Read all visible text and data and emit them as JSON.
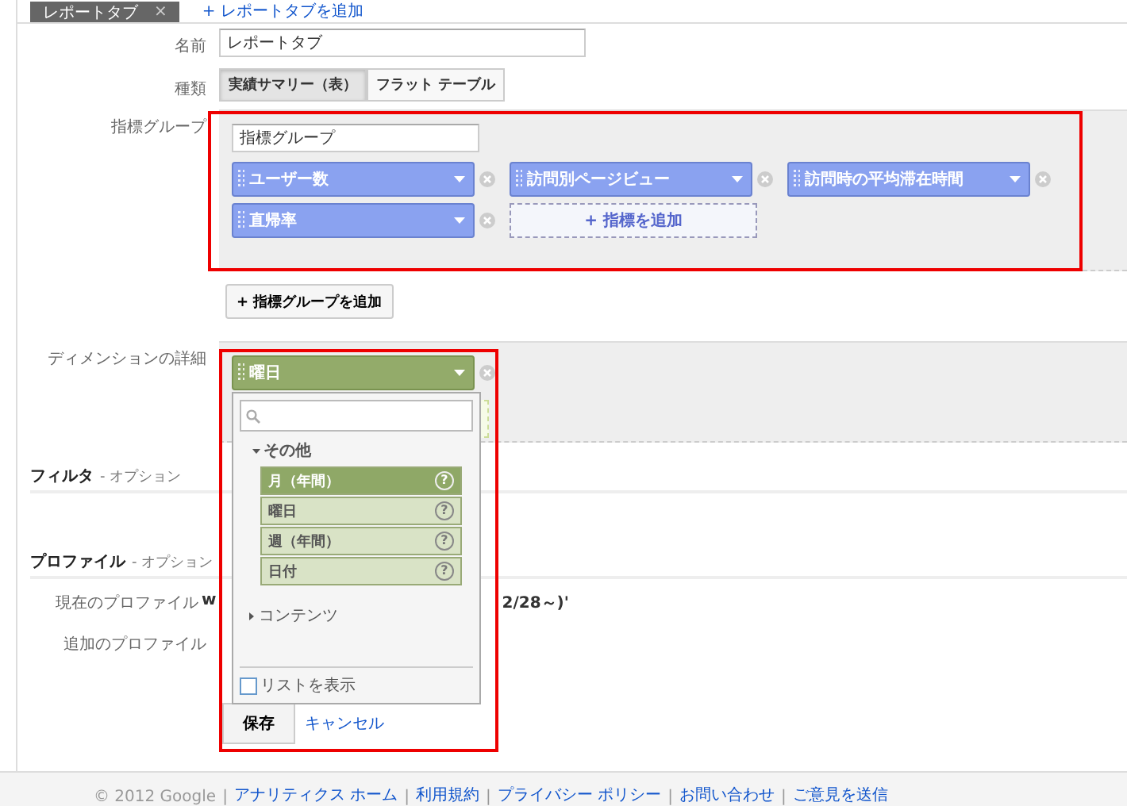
{
  "tabs": {
    "current": {
      "label": "レポートタブ",
      "close": "×"
    },
    "add_link": "+ レポートタブを追加"
  },
  "form": {
    "name": {
      "label": "名前",
      "value": "レポートタブ"
    },
    "type": {
      "label": "種類",
      "options": [
        {
          "label": "実績サマリー（表）",
          "selected": true
        },
        {
          "label": "フラット テーブル",
          "selected": false
        }
      ]
    },
    "metric_group": {
      "label": "指標グループ",
      "group_name": "指標グループ",
      "metrics": [
        {
          "label": "ユーザー数"
        },
        {
          "label": "訪問別ページビュー"
        },
        {
          "label": "訪問時の平均滞在時間"
        },
        {
          "label": "直帰率"
        }
      ],
      "add_metric": "+ 指標を追加",
      "add_group": "+ 指標グループを追加"
    },
    "dimension": {
      "label": "ディメンションの詳細",
      "chip": "曜日"
    }
  },
  "filter": {
    "title": "フィルタ",
    "suffix": "- オプション"
  },
  "profile": {
    "title": "プロファイル",
    "suffix": "- オプション",
    "current_label": "現在のプロファイル",
    "current_value_start": "w",
    "current_value_end": "2/28～)'",
    "additional_label": "追加のプロファイル"
  },
  "actions": {
    "save": "保存",
    "cancel": "キャンセル"
  },
  "dropdown": {
    "category": "その他",
    "expanded": true,
    "items": [
      {
        "label": "月（年間）",
        "selected": true
      },
      {
        "label": "曜日",
        "selected": false
      },
      {
        "label": "週（年間）",
        "selected": false
      },
      {
        "label": "日付",
        "selected": false
      }
    ],
    "help_glyph": "?",
    "collapsed_category": "コンテンツ",
    "show_list": {
      "label": "リストを表示",
      "checked": false
    }
  },
  "footer": {
    "copyright": "© 2012 Google",
    "separator": "|",
    "links": [
      "アナリティクス ホーム",
      "利用規約",
      "プライバシー ポリシー",
      "お問い合わせ",
      "ご意見を送信"
    ]
  }
}
